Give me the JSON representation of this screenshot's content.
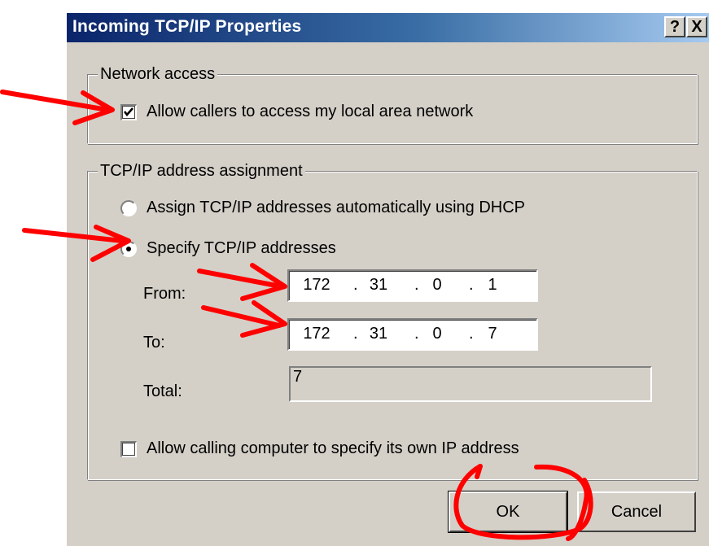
{
  "window": {
    "title": "Incoming TCP/IP Properties",
    "help_label": "?",
    "close_label": "X"
  },
  "network_access": {
    "legend": "Network access",
    "allow_callers_label": "Allow callers to access my local area network",
    "allow_callers_checked": true
  },
  "tcpip": {
    "legend": "TCP/IP address assignment",
    "dhcp_label": "Assign TCP/IP addresses automatically using DHCP",
    "specify_label": "Specify TCP/IP addresses",
    "selected": "specify",
    "from_label": "From:",
    "from_octets": [
      "172",
      "31",
      "0",
      "1"
    ],
    "to_label": "To:",
    "to_octets": [
      "172",
      "31",
      "0",
      "7"
    ],
    "total_label": "Total:",
    "total_value": "7",
    "allow_own_ip_label": "Allow calling computer to specify its own IP address",
    "allow_own_ip_checked": false
  },
  "buttons": {
    "ok": "OK",
    "cancel": "Cancel"
  },
  "annotation_color": "#ff0000"
}
